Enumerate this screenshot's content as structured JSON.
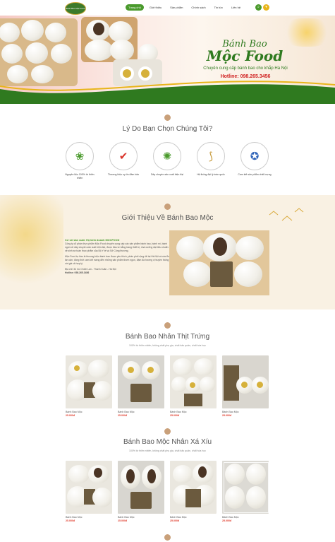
{
  "header": {
    "logo_text": "Bánh Bao Mộc Food",
    "nav": [
      "Trang chủ",
      "Giới thiệu",
      "Sản phẩm",
      "Chính sách",
      "Tin tức",
      "Liên hệ"
    ],
    "active_index": 0
  },
  "banner": {
    "title_line1": "Bánh Bao",
    "title_line2": "Mộc Food",
    "subtitle": "Chuyên cung cấp bánh bao cho khắp Hà Nội",
    "hotline": "Hotline: 098.265.3456"
  },
  "reasons": {
    "title": "Lý Do Bạn Chọn Chúng Tôi?",
    "items": [
      {
        "label": "Nguyên liệu 100% từ thiên nhiên",
        "icon": "organic-badge-icon"
      },
      {
        "label": "Thương hiệu uy tín đảm bảo",
        "icon": "shield-check-icon"
      },
      {
        "label": "Dây chuyền sản xuất hiện đại",
        "icon": "gear-virus-icon"
      },
      {
        "label": "Hệ thống đại lý toàn quốc",
        "icon": "vietnam-map-icon"
      },
      {
        "label": "Cam kết sản phẩm chất lượng",
        "icon": "award-ribbon-icon"
      }
    ]
  },
  "intro": {
    "title": "Giới Thiệu Về Bánh Bao Mộc",
    "heading": "Cơ sở sản xuất: Hộ kinh doanh MOCFOOD",
    "para1": "Công ty cổ phần thực phẩm Mộc Food chuyên cung cấp các sản phẩm bánh bao, bánh mì, bánh ngọt với dây chuyền sản xuất hiện đại, được đầu tư bằng trang thiết bị, nhà xưởng đạt tiêu chuẩn vệ sinh an toàn thực phẩm của Bộ Y tế và Sở Công thương.",
    "para2": "Mộc Food tự hào là thương hiệu bánh bao được yêu thích, phân phối rộng rãi tại Hà Nội và các tỉnh lân cận; đồng thời cam kết mang đến những sản phẩm thơm ngon, đậm đà hương vị truyền thống với giá cả hợp lý.",
    "address": "Địa chỉ: 34 Cù Chính Lan - Thanh Xuân - Hà Nội",
    "hotline": "Hotline: 098.265.3456"
  },
  "section_meat": {
    "title": "Bánh Bao Nhân Thịt Trứng",
    "subtitle": "100% từ thiên nhiên, không chất phụ gia, chất bảo quản, chất hóa học",
    "products": [
      {
        "name": "Bánh Bao Mộc",
        "price": "25.000đ"
      },
      {
        "name": "Bánh Bao Mộc",
        "price": "25.000đ"
      },
      {
        "name": "Bánh Bao Mộc",
        "price": "25.000đ"
      },
      {
        "name": "Bánh Bao Mộc",
        "price": "25.000đ"
      }
    ]
  },
  "section_bbq": {
    "title": "Bánh Bao Mộc Nhân Xá Xíu",
    "subtitle": "100% từ thiên nhiên, không chất phụ gia, chất bảo quản, chất hóa học",
    "products": [
      {
        "name": "Bánh Bao Mộc",
        "price": "25.000đ"
      },
      {
        "name": "Bánh Bao Mộc",
        "price": "25.000đ"
      },
      {
        "name": "Bánh Bao Mộc",
        "price": "25.000đ"
      },
      {
        "name": "Bánh Bao Mộc",
        "price": "25.000đ"
      }
    ]
  },
  "colors": {
    "brand_green": "#4a9a2c",
    "price_red": "#e03a2a",
    "hotline_red": "#d02020"
  }
}
